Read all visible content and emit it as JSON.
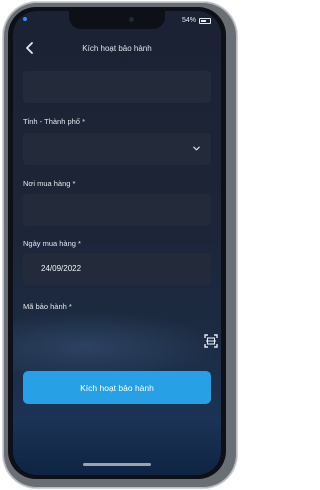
{
  "status_bar": {
    "time": "",
    "battery_text": "54%"
  },
  "nav": {
    "title": "Kích hoạt bảo hành"
  },
  "form": {
    "province_label": "Tỉnh - Thành phố *",
    "store_label": "Nơi mua hàng *",
    "date_label": "Ngày mua hàng *",
    "date_value": "24/09/2022",
    "warranty_label": "Mã bảo hành *"
  },
  "submit": {
    "label": "Kích hoạt bảo hành"
  },
  "colors": {
    "accent": "#27a0e6",
    "field_bg": "#232b3b",
    "screen_bg": "#1d2537"
  },
  "icons": {
    "back": "chevron-left-icon",
    "dropdown": "chevron-down-icon",
    "scan": "scan-icon"
  }
}
